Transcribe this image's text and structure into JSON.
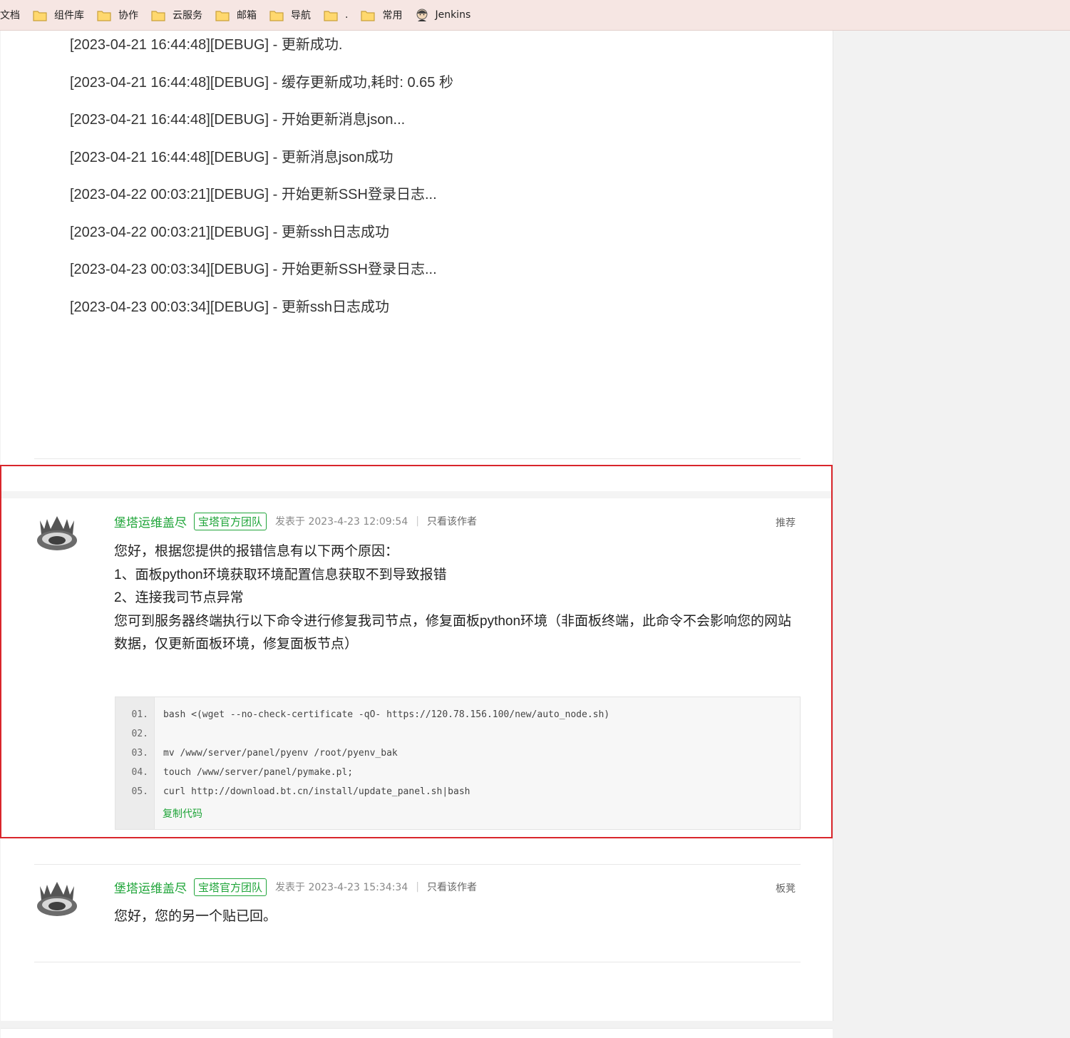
{
  "bookmarks": [
    {
      "label": "文档",
      "icon": "none"
    },
    {
      "label": "组件库",
      "icon": "folder-icon"
    },
    {
      "label": "协作",
      "icon": "folder-icon"
    },
    {
      "label": "云服务",
      "icon": "folder-icon"
    },
    {
      "label": "邮箱",
      "icon": "folder-icon"
    },
    {
      "label": "导航",
      "icon": "folder-icon"
    },
    {
      "label": ".",
      "icon": "folder-icon"
    },
    {
      "label": "常用",
      "icon": "folder-icon"
    },
    {
      "label": "Jenkins",
      "icon": "jenkins-icon"
    }
  ],
  "logs": [
    "[2023-04-21 16:44:48][DEBUG] - 更新成功.",
    "[2023-04-21 16:44:48][DEBUG] - 缓存更新成功,耗时: 0.65 秒",
    "[2023-04-21 16:44:48][DEBUG] - 开始更新消息json...",
    "[2023-04-21 16:44:48][DEBUG] - 更新消息json成功",
    "[2023-04-22 00:03:21][DEBUG] - 开始更新SSH登录日志...",
    "[2023-04-22 00:03:21][DEBUG] - 更新ssh日志成功",
    "[2023-04-23 00:03:34][DEBUG] - 开始更新SSH登录日志...",
    "[2023-04-23 00:03:34][DEBUG] - 更新ssh日志成功"
  ],
  "posts": [
    {
      "author": "堡塔运维盖尽",
      "badge": "宝塔官方团队",
      "posted": "发表于 2023-4-23 12:09:54",
      "divider": "|",
      "only_author": "只看该作者",
      "floor": "推荐",
      "body": [
        "您好，根据您提供的报错信息有以下两个原因：",
        "1、面板python环境获取环境配置信息获取不到导致报错",
        "2、连接我司节点异常",
        "您可到服务器终端执行以下命令进行修复我司节点，修复面板python环境（非面板终端，此命令不会影响您的网站数据，仅更新面板环境，修复面板节点）"
      ],
      "code": {
        "line_numbers": [
          "01.",
          "02.",
          "03.",
          "04.",
          "05."
        ],
        "lines": [
          "bash <(wget --no-check-certificate -qO- https://120.78.156.100/new/auto_node.sh)",
          "",
          "mv /www/server/panel/pyenv /root/pyenv_bak",
          "touch /www/server/panel/pymake.pl;",
          "curl http://download.bt.cn/install/update_panel.sh|bash"
        ],
        "copy_label": "复制代码"
      }
    },
    {
      "author": "堡塔运维盖尽",
      "badge": "宝塔官方团队",
      "posted": "发表于 2023-4-23 15:34:34",
      "divider": "|",
      "only_author": "只看该作者",
      "floor": "板凳",
      "body": [
        "您好，您的另一个贴已回。"
      ]
    }
  ],
  "colors": {
    "accent_green": "#20a53a",
    "highlight_red": "#d9262b",
    "bookmark_bar_bg": "#f6e6e3"
  }
}
